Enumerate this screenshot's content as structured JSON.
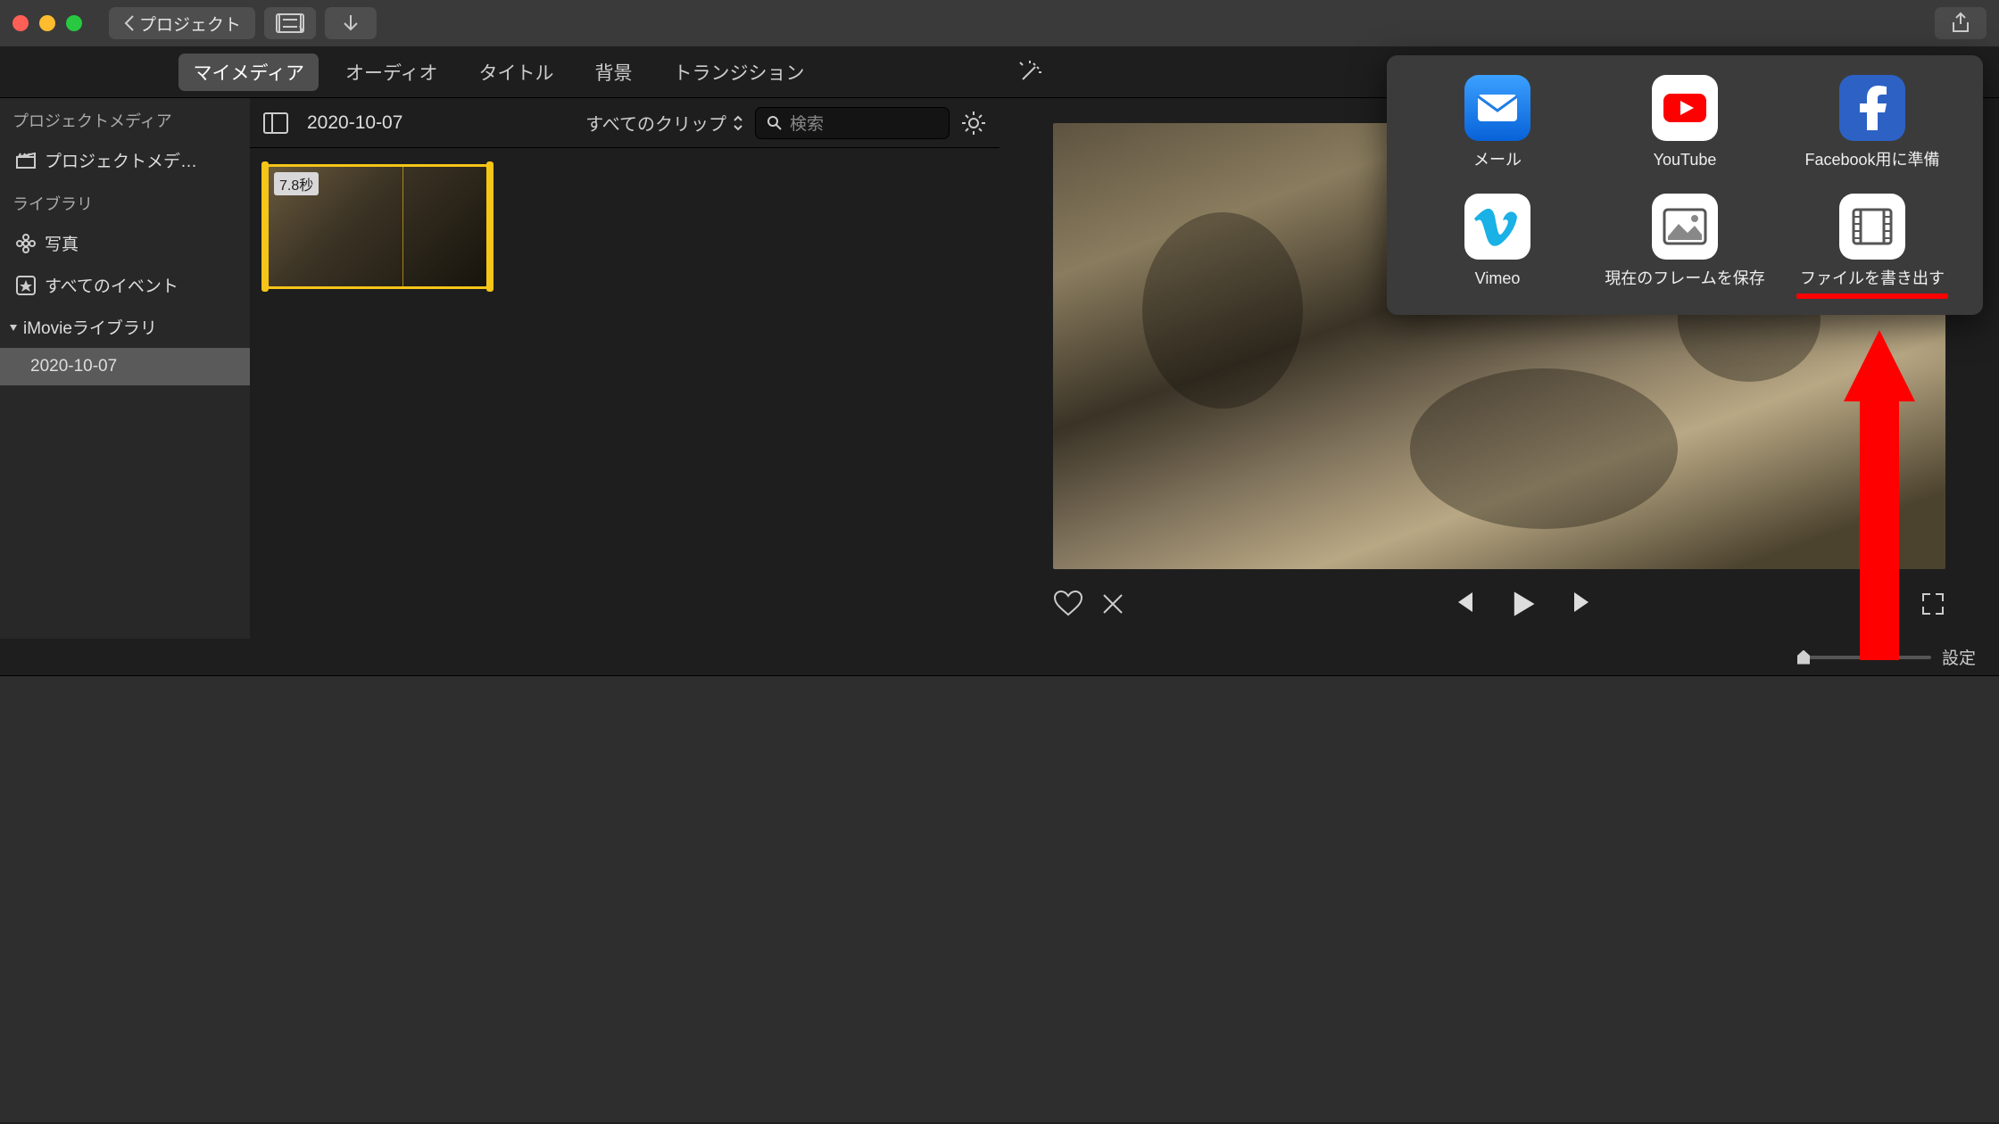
{
  "titlebar": {
    "back_label": "プロジェクト"
  },
  "tabs": {
    "my_media": "マイメディア",
    "audio": "オーディオ",
    "titles": "タイトル",
    "backgrounds": "背景",
    "transitions": "トランジション"
  },
  "sidebar": {
    "project_media_header": "プロジェクトメディア",
    "project_media_item": "プロジェクトメデ…",
    "library_header": "ライブラリ",
    "photos": "写真",
    "all_events": "すべてのイベント",
    "imovie_library": "iMovieライブラリ",
    "event_date": "2020-10-07"
  },
  "browser": {
    "title": "2020-10-07",
    "filter": "すべてのクリップ",
    "search_placeholder": "検索",
    "clip_duration": "7.8秒"
  },
  "share": {
    "mail": "メール",
    "youtube": "YouTube",
    "facebook": "Facebook用に準備",
    "vimeo": "Vimeo",
    "save_frame": "現在のフレームを保存",
    "export_file": "ファイルを書き出す"
  },
  "timeline": {
    "settings": "設定"
  }
}
